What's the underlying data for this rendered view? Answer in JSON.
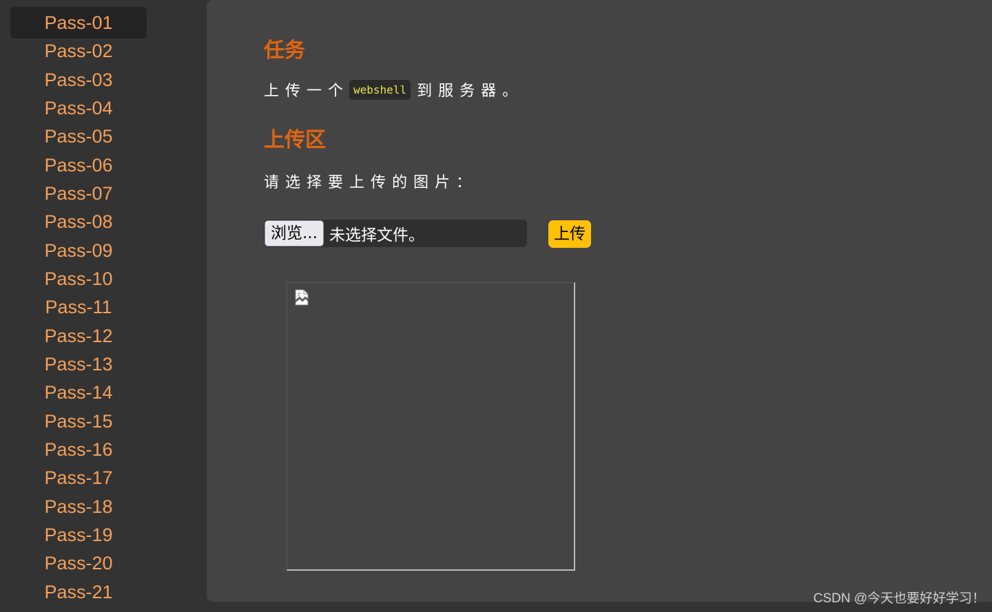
{
  "sidebar": {
    "items": [
      {
        "label": "Pass-01"
      },
      {
        "label": "Pass-02"
      },
      {
        "label": "Pass-03"
      },
      {
        "label": "Pass-04"
      },
      {
        "label": "Pass-05"
      },
      {
        "label": "Pass-06"
      },
      {
        "label": "Pass-07"
      },
      {
        "label": "Pass-08"
      },
      {
        "label": "Pass-09"
      },
      {
        "label": "Pass-10"
      },
      {
        "label": "Pass-11"
      },
      {
        "label": "Pass-12"
      },
      {
        "label": "Pass-13"
      },
      {
        "label": "Pass-14"
      },
      {
        "label": "Pass-15"
      },
      {
        "label": "Pass-16"
      },
      {
        "label": "Pass-17"
      },
      {
        "label": "Pass-18"
      },
      {
        "label": "Pass-19"
      },
      {
        "label": "Pass-20"
      },
      {
        "label": "Pass-21"
      }
    ],
    "active_index": 0
  },
  "task": {
    "heading": "任务",
    "text_before": "上传一个",
    "code": "webshell",
    "text_after": "到服务器。"
  },
  "upload": {
    "heading": "上传区",
    "prompt": "请选择要上传的图片：",
    "browse_label": "浏览...",
    "file_status": "未选择文件。",
    "submit_label": "上传"
  },
  "preview": {
    "icon": "broken-image-icon"
  },
  "watermark": "CSDN @今天也要好好学习！",
  "colors": {
    "link": "#f5a05a",
    "heading": "#e26610",
    "code_text": "#e8e44a",
    "upload_button": "#ffc107"
  }
}
